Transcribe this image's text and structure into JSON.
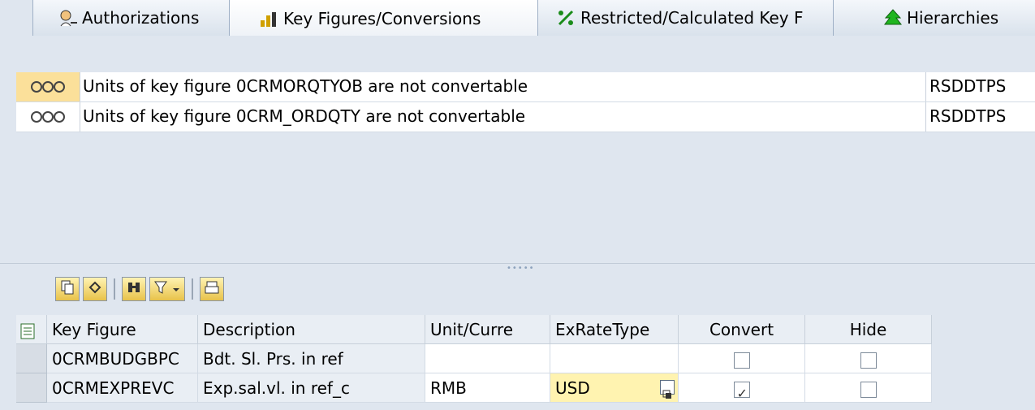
{
  "tabs": [
    {
      "label": "Authorizations",
      "icon": "authorizations-icon"
    },
    {
      "label": "Key Figures/Conversions",
      "icon": "key-figures-icon"
    },
    {
      "label": "Restricted/Calculated Key F",
      "icon": "restricted-calc-icon"
    },
    {
      "label": "Hierarchies",
      "icon": "hierarchies-icon"
    }
  ],
  "messages": [
    {
      "text": "Units of key figure 0CRMORQTYOB are not convertable",
      "program": "RSDDTPS"
    },
    {
      "text": "Units of key figure 0CRM_ORDQTY are not convertable",
      "program": "RSDDTPS"
    }
  ],
  "toolbar": {
    "buttons": [
      "copy-icon",
      "undo-icon",
      "find-icon",
      "filter-icon",
      "print-icon"
    ]
  },
  "grid": {
    "columns": [
      "Key Figure",
      "Description",
      "Unit/Curre",
      "ExRateType",
      "Convert",
      "Hide"
    ],
    "rows": [
      {
        "key": "0CRMBUDGBPC",
        "desc": "Bdt. Sl. Prs. in ref",
        "unit": "",
        "rate": "",
        "convert": false,
        "hide": false
      },
      {
        "key": "0CRMEXPREVC",
        "desc": "Exp.sal.vl. in ref_c",
        "unit": "RMB",
        "rate": "USD",
        "convert": true,
        "hide": false
      }
    ]
  },
  "colors": {
    "accent": "#fbe09a",
    "background": "#dfe6ef"
  }
}
